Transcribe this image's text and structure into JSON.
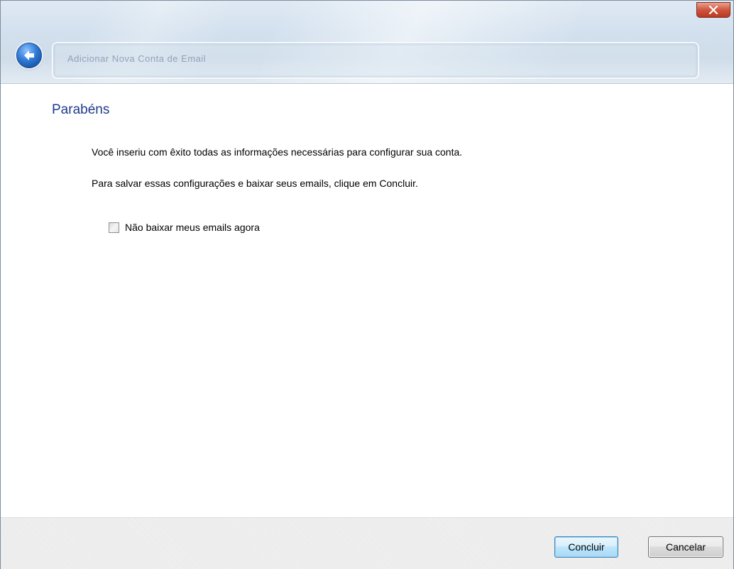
{
  "titlebar": {
    "caption": "Adicionar Nova Conta de Email"
  },
  "content": {
    "heading": "Parabéns",
    "message_1": "Você inseriu com êxito todas as informações necessárias para configurar sua conta.",
    "message_2": "Para salvar essas configurações e baixar seus emails, clique em Concluir.",
    "checkbox": {
      "label": "Não baixar meus emails agora",
      "checked": false
    }
  },
  "footer": {
    "finish_label": "Concluir",
    "cancel_label": "Cancelar"
  },
  "colors": {
    "heading": "#1e3c8c",
    "primary_border": "#3c7fb1"
  },
  "icons": {
    "back": "back-arrow-icon",
    "close": "close-icon"
  }
}
